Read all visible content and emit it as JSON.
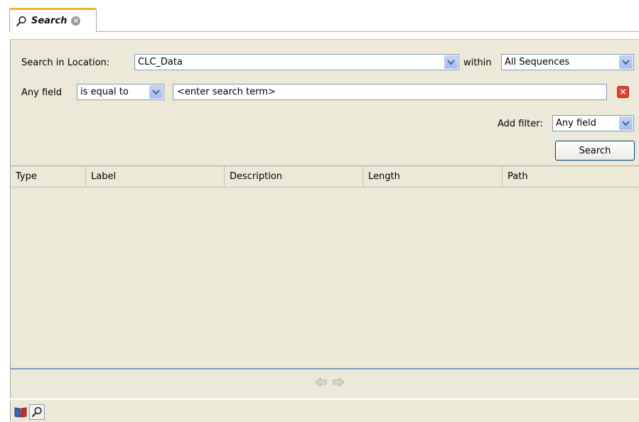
{
  "tab": {
    "title": "Search",
    "close_icon": "close-icon"
  },
  "search_in_location": {
    "label": "Search in Location:",
    "value": "CLC_Data",
    "within_label": "within",
    "within_value": "All Sequences"
  },
  "filter": {
    "field_label": "Any field",
    "operator": "is equal to",
    "term_placeholder": "<enter search term>"
  },
  "add_filter": {
    "label": "Add filter:",
    "value": "Any field"
  },
  "search_button": "Search",
  "table": {
    "columns": [
      "Type",
      "Label",
      "Description",
      "Length",
      "Path"
    ],
    "rows": []
  },
  "colors": {
    "tab_accent": "#f3b02e",
    "panel_bg": "#ece9d8",
    "field_border": "#7f9db9",
    "delete_red": "#e0432e"
  },
  "icons": {
    "pager_prev": "arrow-left-icon",
    "pager_next": "arrow-right-icon",
    "book": "book-icon",
    "search": "search-icon"
  }
}
